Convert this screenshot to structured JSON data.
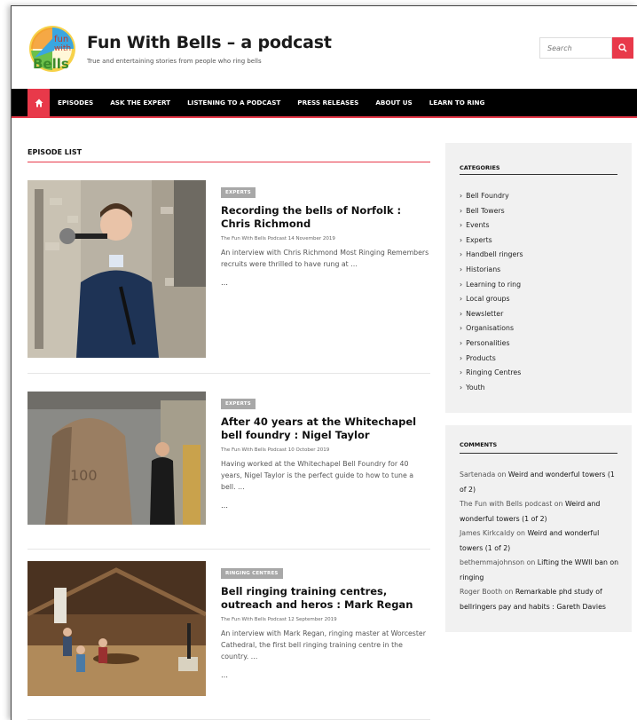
{
  "site": {
    "title": "Fun With Bells – a podcast",
    "tagline": "True and entertaining stories from people who ring bells",
    "logo": {
      "line1": "fun",
      "line2": "with",
      "line3": "Bells"
    }
  },
  "search": {
    "placeholder": "Search"
  },
  "nav": {
    "items": [
      "EPISODES",
      "ASK THE EXPERT",
      "LISTENING TO A PODCAST",
      "PRESS RELEASES",
      "ABOUT US",
      "LEARN TO RING"
    ]
  },
  "main": {
    "section_title": "EPISODE LIST",
    "posts": [
      {
        "category": "EXPERTS",
        "title": "Recording the bells of Norfolk : Chris Richmond",
        "meta": "The Fun With Bells Podcast 14 November 2019",
        "excerpt": "An interview with Chris Richmond Most Ringing Remembers recruits were thrilled to have rung at …",
        "more": "…"
      },
      {
        "category": "EXPERTS",
        "title": "After 40 years at the Whitechapel bell foundry : Nigel Taylor",
        "meta": "The Fun With Bells Podcast 10 October 2019",
        "excerpt": "Having worked at the Whitechapel Bell Foundry for 40 years, Nigel Taylor is the perfect guide to how to tune a bell. …",
        "more": "…"
      },
      {
        "category": "RINGING CENTRES",
        "title": "Bell ringing training centres, outreach and heros : Mark Regan",
        "meta": "The Fun With Bells Podcast 12 September 2019",
        "excerpt": "An interview with Mark Regan, ringing master at Worcester Cathedral, the first bell ringing training centre in the country. …",
        "more": "…"
      }
    ]
  },
  "sidebar": {
    "categories": {
      "title": "CATEGORIES",
      "items": [
        "Bell Foundry",
        "Bell Towers",
        "Events",
        "Experts",
        "Handbell ringers",
        "Historians",
        "Learning to ring",
        "Local groups",
        "Newsletter",
        "Organisations",
        "Personalities",
        "Products",
        "Ringing Centres",
        "Youth"
      ]
    },
    "comments": {
      "title": "COMMENTS",
      "items": [
        {
          "author": "Sartenada",
          "on": " on ",
          "post": "Weird and wonderful towers (1 of 2)"
        },
        {
          "author": "The Fun with Bells podcast",
          "on": " on ",
          "post": "Weird and wonderful towers (1 of 2)"
        },
        {
          "author": "James Kirkcaldy",
          "on": " on ",
          "post": "Weird and wonderful towers (1 of 2)"
        },
        {
          "author": "bethemmajohnson",
          "on": " on ",
          "post": "Lifting the WWII ban on ringing"
        },
        {
          "author": "Roger Booth",
          "on": " on ",
          "post": "Remarkable phd study of bellringers pay and habits : Gareth Davies"
        }
      ]
    }
  },
  "colors": {
    "accent": "#e8394a",
    "nav_bg": "#000000",
    "badge": "#a8a8a8",
    "sidebar_bg": "#f1f1f1"
  },
  "icons": {
    "home": "home-icon",
    "search": "search-icon"
  }
}
